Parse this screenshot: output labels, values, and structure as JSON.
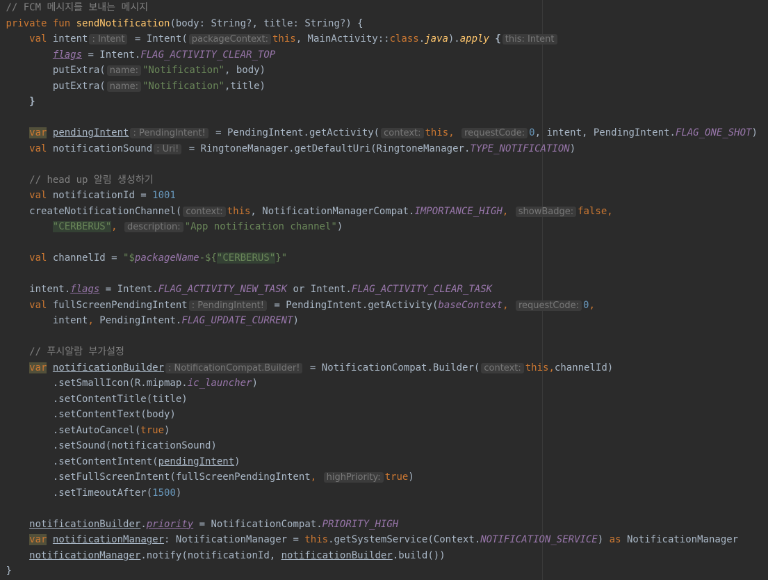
{
  "editor": {
    "lines": [
      {
        "indent": "",
        "tokens": [
          {
            "t": "// FCM 메시지를 보내는 메시지",
            "c": "comment"
          }
        ]
      },
      {
        "indent": "",
        "tokens": [
          {
            "t": "private ",
            "c": "kw"
          },
          {
            "t": "fun ",
            "c": "kw"
          },
          {
            "t": "sendNotification",
            "c": "fn"
          },
          {
            "t": "(body: String?, title: String?) {",
            "c": ""
          }
        ]
      },
      {
        "indent": "    ",
        "tokens": [
          {
            "t": "val ",
            "c": "kw"
          },
          {
            "t": "intent",
            "c": ""
          },
          {
            "t": ": Intent",
            "c": "hint"
          },
          {
            "t": " = Intent(",
            "c": ""
          },
          {
            "t": "packageContext:",
            "c": "hint"
          },
          {
            "t": "this",
            "c": "kw"
          },
          {
            "t": ", MainActivity::",
            "c": ""
          },
          {
            "t": "class",
            "c": "kw"
          },
          {
            "t": ".",
            "c": ""
          },
          {
            "t": "java",
            "c": "ext"
          },
          {
            "t": ").",
            "c": ""
          },
          {
            "t": "apply",
            "c": "ext"
          },
          {
            "t": " {",
            "c": "brace"
          },
          {
            "t": "this: Intent",
            "c": "hint"
          }
        ]
      },
      {
        "indent": "        ",
        "tokens": [
          {
            "t": "flags",
            "c": "const ul"
          },
          {
            "t": " = Intent.",
            "c": ""
          },
          {
            "t": "FLAG_ACTIVITY_CLEAR_TOP",
            "c": "const"
          }
        ]
      },
      {
        "indent": "        ",
        "tokens": [
          {
            "t": "putExtra(",
            "c": ""
          },
          {
            "t": "name:",
            "c": "hint"
          },
          {
            "t": "\"Notification\"",
            "c": "str"
          },
          {
            "t": ", body)",
            "c": ""
          }
        ]
      },
      {
        "indent": "        ",
        "tokens": [
          {
            "t": "putExtra(",
            "c": ""
          },
          {
            "t": "name:",
            "c": "hint"
          },
          {
            "t": "\"Notification\"",
            "c": "str"
          },
          {
            "t": ",title)",
            "c": ""
          }
        ]
      },
      {
        "indent": "    ",
        "tokens": [
          {
            "t": "}",
            "c": "brace"
          }
        ]
      },
      {
        "indent": "",
        "tokens": []
      },
      {
        "indent": "    ",
        "tokens": [
          {
            "t": "var",
            "c": "kw hl"
          },
          {
            "t": " ",
            "c": ""
          },
          {
            "t": "pendingIntent",
            "c": "ul"
          },
          {
            "t": ": PendingIntent!",
            "c": "hint"
          },
          {
            "t": " = PendingIntent.getActivity(",
            "c": ""
          },
          {
            "t": "context:",
            "c": "hint"
          },
          {
            "t": "this",
            "c": "kw"
          },
          {
            "t": ", ",
            "c": "kw"
          },
          {
            "t": "requestCode:",
            "c": "hint"
          },
          {
            "t": "0",
            "c": "num"
          },
          {
            "t": ", intent, PendingIntent.",
            "c": ""
          },
          {
            "t": "FLAG_ONE_SHOT",
            "c": "const"
          },
          {
            "t": ")",
            "c": ""
          }
        ]
      },
      {
        "indent": "    ",
        "tokens": [
          {
            "t": "val ",
            "c": "kw"
          },
          {
            "t": "notificationSound",
            "c": ""
          },
          {
            "t": ": Uri!",
            "c": "hint"
          },
          {
            "t": " = RingtoneManager.getDefaultUri(RingtoneManager.",
            "c": ""
          },
          {
            "t": "TYPE_NOTIFICATION",
            "c": "const"
          },
          {
            "t": ")",
            "c": ""
          }
        ]
      },
      {
        "indent": "",
        "tokens": []
      },
      {
        "indent": "    ",
        "tokens": [
          {
            "t": "// head up 알림 생성하기",
            "c": "comment"
          }
        ]
      },
      {
        "indent": "    ",
        "tokens": [
          {
            "t": "val ",
            "c": "kw"
          },
          {
            "t": "notificationId = ",
            "c": ""
          },
          {
            "t": "1001",
            "c": "num"
          }
        ]
      },
      {
        "indent": "    ",
        "tokens": [
          {
            "t": "createNotificationChannel(",
            "c": ""
          },
          {
            "t": "context:",
            "c": "hint"
          },
          {
            "t": "this",
            "c": "kw"
          },
          {
            "t": ", NotificationManagerCompat.",
            "c": ""
          },
          {
            "t": "IMPORTANCE_HIGH",
            "c": "const"
          },
          {
            "t": ", ",
            "c": "kw"
          },
          {
            "t": "showBadge:",
            "c": "hint"
          },
          {
            "t": "false",
            "c": "kw"
          },
          {
            "t": ",",
            "c": "kw"
          }
        ]
      },
      {
        "indent": "        ",
        "tokens": [
          {
            "t": "\"CERBERUS\"",
            "c": "str hlstr"
          },
          {
            "t": ", ",
            "c": "kw"
          },
          {
            "t": "description:",
            "c": "hint"
          },
          {
            "t": "\"App notification channel\"",
            "c": "str"
          },
          {
            "t": ")",
            "c": ""
          }
        ]
      },
      {
        "indent": "",
        "tokens": []
      },
      {
        "indent": "    ",
        "tokens": [
          {
            "t": "val ",
            "c": "kw"
          },
          {
            "t": "channelId = ",
            "c": ""
          },
          {
            "t": "\"$",
            "c": "str"
          },
          {
            "t": "packageName",
            "c": "const"
          },
          {
            "t": "-${",
            "c": "str"
          },
          {
            "t": "\"CERBERUS\"",
            "c": "str hlstr"
          },
          {
            "t": "}\"",
            "c": "str"
          }
        ]
      },
      {
        "indent": "",
        "tokens": []
      },
      {
        "indent": "    ",
        "tokens": [
          {
            "t": "intent.",
            "c": ""
          },
          {
            "t": "flags",
            "c": "const ul"
          },
          {
            "t": " = Intent.",
            "c": ""
          },
          {
            "t": "FLAG_ACTIVITY_NEW_TASK",
            "c": "const"
          },
          {
            "t": " or Intent.",
            "c": ""
          },
          {
            "t": "FLAG_ACTIVITY_CLEAR_TASK",
            "c": "const"
          }
        ]
      },
      {
        "indent": "    ",
        "tokens": [
          {
            "t": "val ",
            "c": "kw"
          },
          {
            "t": "fullScreenPendingIntent",
            "c": ""
          },
          {
            "t": ": PendingIntent!",
            "c": "hint"
          },
          {
            "t": " = PendingIntent.getActivity(",
            "c": ""
          },
          {
            "t": "baseContext",
            "c": "const"
          },
          {
            "t": ", ",
            "c": "kw"
          },
          {
            "t": "requestCode:",
            "c": "hint"
          },
          {
            "t": "0",
            "c": "num"
          },
          {
            "t": ",",
            "c": "kw"
          }
        ]
      },
      {
        "indent": "        ",
        "tokens": [
          {
            "t": "intent",
            "c": ""
          },
          {
            "t": ", ",
            "c": "kw"
          },
          {
            "t": "PendingIntent.",
            "c": ""
          },
          {
            "t": "FLAG_UPDATE_CURRENT",
            "c": "const"
          },
          {
            "t": ")",
            "c": ""
          }
        ]
      },
      {
        "indent": "",
        "tokens": []
      },
      {
        "indent": "    ",
        "tokens": [
          {
            "t": "// 푸시알람 부가설정",
            "c": "comment"
          }
        ]
      },
      {
        "indent": "    ",
        "tokens": [
          {
            "t": "var",
            "c": "kw hl"
          },
          {
            "t": " ",
            "c": ""
          },
          {
            "t": "notificationBuilder",
            "c": "ul"
          },
          {
            "t": ": NotificationCompat.Builder!",
            "c": "hint"
          },
          {
            "t": " = NotificationCompat.Builder(",
            "c": ""
          },
          {
            "t": "context:",
            "c": "hint"
          },
          {
            "t": "this",
            "c": "kw"
          },
          {
            "t": ",",
            "c": "kw"
          },
          {
            "t": "channelId)",
            "c": ""
          }
        ]
      },
      {
        "indent": "        ",
        "tokens": [
          {
            "t": ".setSmallIcon(R.mipmap.",
            "c": ""
          },
          {
            "t": "ic_launcher",
            "c": "const"
          },
          {
            "t": ")",
            "c": ""
          }
        ]
      },
      {
        "indent": "        ",
        "tokens": [
          {
            "t": ".setContentTitle(title)",
            "c": ""
          }
        ]
      },
      {
        "indent": "        ",
        "tokens": [
          {
            "t": ".setContentText(body)",
            "c": ""
          }
        ]
      },
      {
        "indent": "        ",
        "tokens": [
          {
            "t": ".setAutoCancel(",
            "c": ""
          },
          {
            "t": "true",
            "c": "kw"
          },
          {
            "t": ")",
            "c": ""
          }
        ]
      },
      {
        "indent": "        ",
        "tokens": [
          {
            "t": ".setSound(notificationSound)",
            "c": ""
          }
        ]
      },
      {
        "indent": "        ",
        "tokens": [
          {
            "t": ".setContentIntent(",
            "c": ""
          },
          {
            "t": "pendingIntent",
            "c": "ul"
          },
          {
            "t": ")",
            "c": ""
          }
        ]
      },
      {
        "indent": "        ",
        "tokens": [
          {
            "t": ".setFullScreenIntent(fullScreenPendingIntent",
            "c": ""
          },
          {
            "t": ", ",
            "c": "kw"
          },
          {
            "t": "highPriority:",
            "c": "hint"
          },
          {
            "t": "true",
            "c": "kw"
          },
          {
            "t": ")",
            "c": ""
          }
        ]
      },
      {
        "indent": "        ",
        "tokens": [
          {
            "t": ".setTimeoutAfter(",
            "c": ""
          },
          {
            "t": "1500",
            "c": "num"
          },
          {
            "t": ")",
            "c": ""
          }
        ]
      },
      {
        "indent": "",
        "tokens": []
      },
      {
        "indent": "    ",
        "tokens": [
          {
            "t": "notificationBuilder",
            "c": "ul"
          },
          {
            "t": ".",
            "c": ""
          },
          {
            "t": "priority",
            "c": "const ul"
          },
          {
            "t": " = NotificationCompat.",
            "c": ""
          },
          {
            "t": "PRIORITY_HIGH",
            "c": "const"
          }
        ]
      },
      {
        "indent": "    ",
        "tokens": [
          {
            "t": "var",
            "c": "kw hl"
          },
          {
            "t": " ",
            "c": ""
          },
          {
            "t": "notificationManager",
            "c": "ul"
          },
          {
            "t": ": NotificationManager = ",
            "c": ""
          },
          {
            "t": "this",
            "c": "kw"
          },
          {
            "t": ".getSystemService(Context.",
            "c": ""
          },
          {
            "t": "NOTIFICATION_SERVICE",
            "c": "const"
          },
          {
            "t": ") ",
            "c": ""
          },
          {
            "t": "as ",
            "c": "kw"
          },
          {
            "t": "NotificationManager",
            "c": ""
          }
        ]
      },
      {
        "indent": "    ",
        "tokens": [
          {
            "t": "notificationManager",
            "c": "ul"
          },
          {
            "t": ".notify(notificationId, ",
            "c": ""
          },
          {
            "t": "notificationBuilder",
            "c": "ul"
          },
          {
            "t": ".build())",
            "c": ""
          }
        ]
      },
      {
        "indent": "",
        "tokens": [
          {
            "t": "}",
            "c": ""
          }
        ]
      }
    ]
  }
}
